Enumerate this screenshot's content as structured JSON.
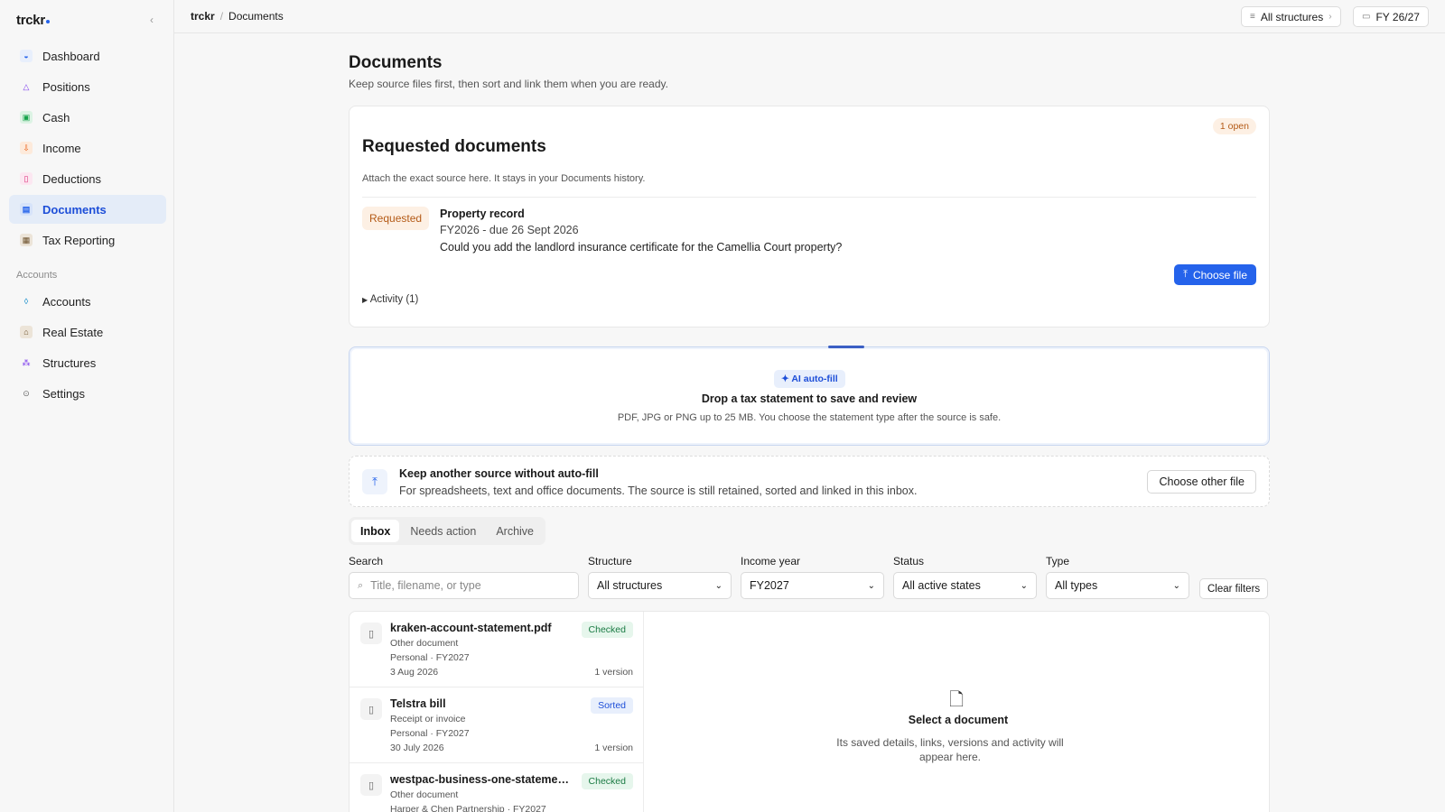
{
  "app": {
    "logo": "trckr"
  },
  "sidebar": {
    "items": [
      {
        "label": "Dashboard",
        "icon": "dashboard-icon",
        "color": "#2563eb"
      },
      {
        "label": "Positions",
        "icon": "positions-icon",
        "color": "#7c3aed"
      },
      {
        "label": "Cash",
        "icon": "cash-icon",
        "color": "#16a34a"
      },
      {
        "label": "Income",
        "icon": "income-icon",
        "color": "#ea580c"
      },
      {
        "label": "Deductions",
        "icon": "deductions-icon",
        "color": "#db2777"
      },
      {
        "label": "Documents",
        "icon": "documents-icon",
        "color": "#2563eb"
      },
      {
        "label": "Tax Reporting",
        "icon": "tax-reporting-icon",
        "color": "#6b4f2a"
      }
    ],
    "section_label": "Accounts",
    "account_items": [
      {
        "label": "Accounts",
        "icon": "accounts-icon",
        "color": "#0284c7"
      },
      {
        "label": "Real Estate",
        "icon": "real-estate-icon",
        "color": "#6b4f2a"
      },
      {
        "label": "Structures",
        "icon": "structures-icon",
        "color": "#7c3aed"
      },
      {
        "label": "Settings",
        "icon": "settings-icon",
        "color": "#666666"
      }
    ],
    "active": "Documents"
  },
  "topbar": {
    "breadcrumb_home": "trckr",
    "breadcrumb_current": "Documents",
    "structures_button": "All structures",
    "fy_button": "FY 26/27"
  },
  "page": {
    "title": "Documents",
    "subtitle": "Keep source files first, then sort and link them when you are ready."
  },
  "requested": {
    "title": "Requested documents",
    "open_badge": "1 open",
    "description": "Attach the exact source here. It stays in your Documents history.",
    "status": "Requested",
    "name": "Property record",
    "due": "FY2026 - due 26 Sept 2026",
    "message": "Could you add the landlord insurance certificate for the Camellia Court property?",
    "choose_button": "Choose file",
    "activity": "Activity (1)"
  },
  "dropzone": {
    "badge": "AI auto-fill",
    "title": "Drop a tax statement to save and review",
    "subtitle": "PDF, JPG or PNG up to 25 MB. You choose the statement type after the source is safe."
  },
  "keep": {
    "title": "Keep another source without auto-fill",
    "subtitle": "For spreadsheets, text and office documents. The source is still retained, sorted and linked in this inbox.",
    "button": "Choose other file"
  },
  "tabs": [
    "Inbox",
    "Needs action",
    "Archive"
  ],
  "active_tab": "Inbox",
  "filters": {
    "search_label": "Search",
    "search_placeholder": "Title, filename, or type",
    "structure_label": "Structure",
    "structure_value": "All structures",
    "income_year_label": "Income year",
    "income_year_value": "FY2027",
    "status_label": "Status",
    "status_value": "All active states",
    "type_label": "Type",
    "type_value": "All types",
    "clear_button": "Clear filters"
  },
  "documents": [
    {
      "name": "kraken-account-statement.pdf",
      "kind": "Other document",
      "meta": "Personal · FY2027",
      "date": "3 Aug 2026",
      "versions": "1 version",
      "status": "Checked"
    },
    {
      "name": "Telstra bill",
      "kind": "Receipt or invoice",
      "meta": "Personal · FY2027",
      "date": "30 July 2026",
      "versions": "1 version",
      "status": "Sorted"
    },
    {
      "name": "westpac-business-one-statement.pdf",
      "kind": "Other document",
      "meta": "Harper & Chen Partnership · FY2027",
      "date": "",
      "versions": "",
      "status": "Checked"
    }
  ],
  "empty_state": {
    "title": "Select a document",
    "subtitle": "Its saved details, links, versions and activity will appear here."
  }
}
